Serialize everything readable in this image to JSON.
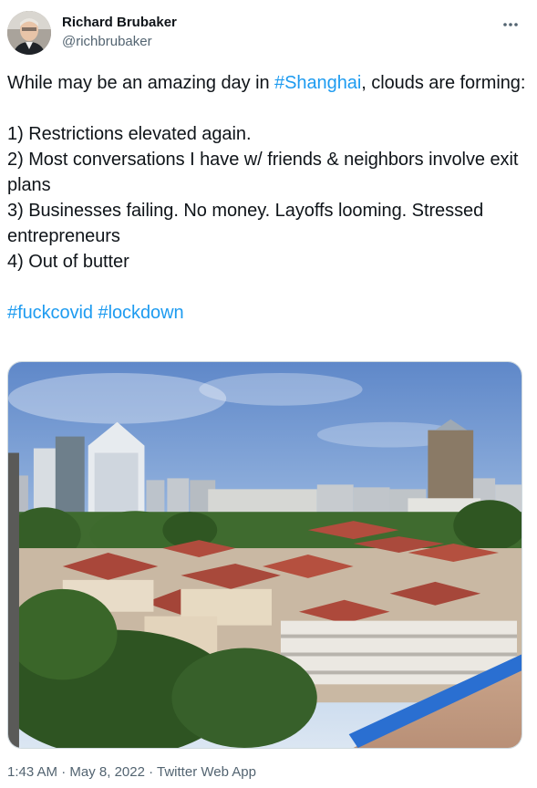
{
  "author": {
    "display_name": "Richard Brubaker",
    "handle": "@richbrubaker"
  },
  "tweet": {
    "line1_prefix": "While may be an amazing day in ",
    "line1_hashtag": "#Shanghai",
    "line1_suffix": ", clouds are forming:",
    "item1": "1) Restrictions elevated again.",
    "item2": "2) Most conversations I have w/ friends & neighbors involve exit plans",
    "item3": "3) Businesses failing. No money. Layoffs looming. Stressed entrepreneurs",
    "item4": "4) Out of butter",
    "hashtag1": "#fuckcovid",
    "hashtag2": "#lockdown"
  },
  "meta": {
    "time": "1:43 AM",
    "separator": " · ",
    "date": "May 8, 2022",
    "source": "Twitter Web App"
  },
  "icons": {
    "more": "more-horizontal-icon"
  },
  "colors": {
    "link": "#1d9bf0",
    "text": "#0f1419",
    "secondary": "#536471"
  }
}
